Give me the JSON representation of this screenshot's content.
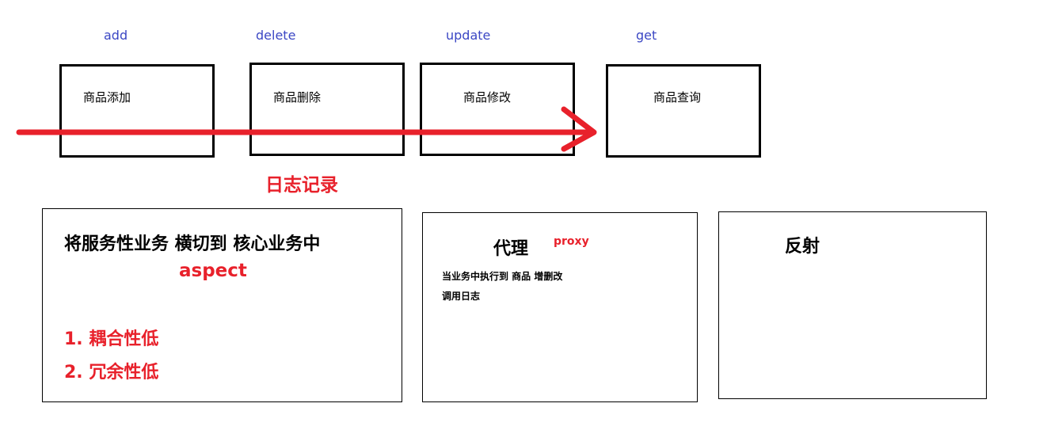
{
  "top": {
    "ops": [
      {
        "method": "add",
        "label": "商品添加"
      },
      {
        "method": "delete",
        "label": "商品删除"
      },
      {
        "method": "update",
        "label": "商品修改"
      },
      {
        "method": "get",
        "label": "商品查询"
      }
    ],
    "log_label": "日志记录",
    "arrow_color": "#e8212b"
  },
  "panels": {
    "aspect": {
      "heading": "将服务性业务 横切到 核心业务中",
      "term": "aspect",
      "points": [
        "1. 耦合性低",
        "2. 冗余性低"
      ]
    },
    "proxy": {
      "title": "代理",
      "term": "proxy",
      "lines": [
        "当业务中执行到 商品 增删改",
        "调用日志"
      ]
    },
    "reflection": {
      "title": "反射"
    }
  },
  "colors": {
    "accent_red": "#e8212b",
    "method_blue": "#3b47c4",
    "ink": "#000000"
  }
}
